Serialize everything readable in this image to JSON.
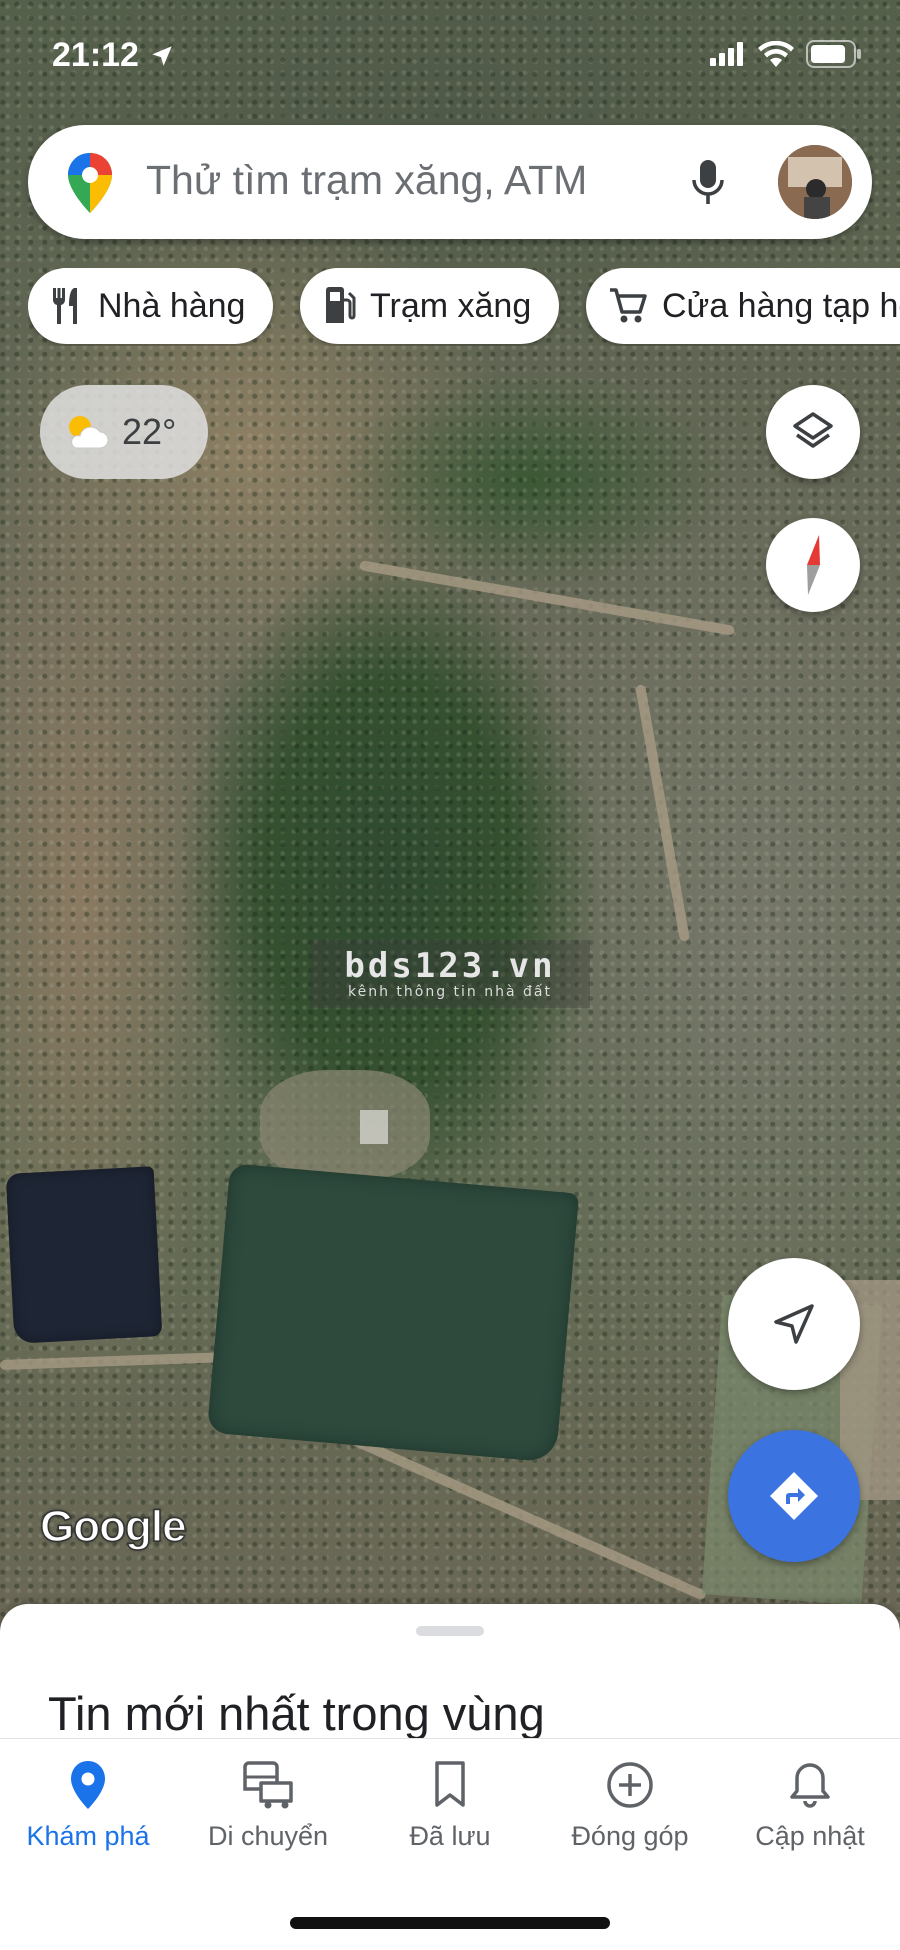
{
  "status_bar": {
    "time": "21:12"
  },
  "search": {
    "placeholder": "Thử tìm trạm xăng, ATM"
  },
  "chips": [
    {
      "label": "Nhà hàng",
      "icon": "restaurant-icon"
    },
    {
      "label": "Trạm xăng",
      "icon": "gas-station-icon"
    },
    {
      "label": "Cửa hàng tạp hóa",
      "icon": "shopping-cart-icon"
    }
  ],
  "weather": {
    "temperature": "22°",
    "icon": "partly-cloudy-icon"
  },
  "map": {
    "watermark_title": "bds123.vn",
    "watermark_subtitle": "kênh thông tin nhà đất",
    "attribution": "Google"
  },
  "sheet": {
    "title": "Tin mới nhất trong vùng"
  },
  "nav": [
    {
      "label": "Khám phá",
      "icon": "explore-pin-icon",
      "active": true
    },
    {
      "label": "Di chuyển",
      "icon": "commute-icon",
      "active": false
    },
    {
      "label": "Đã lưu",
      "icon": "bookmark-icon",
      "active": false
    },
    {
      "label": "Đóng góp",
      "icon": "add-circle-icon",
      "active": false
    },
    {
      "label": "Cập nhật",
      "icon": "bell-icon",
      "active": false
    }
  ],
  "colors": {
    "accent": "#1a73e8",
    "directions_fab": "#3b73e0",
    "compass_red": "#e53935"
  }
}
